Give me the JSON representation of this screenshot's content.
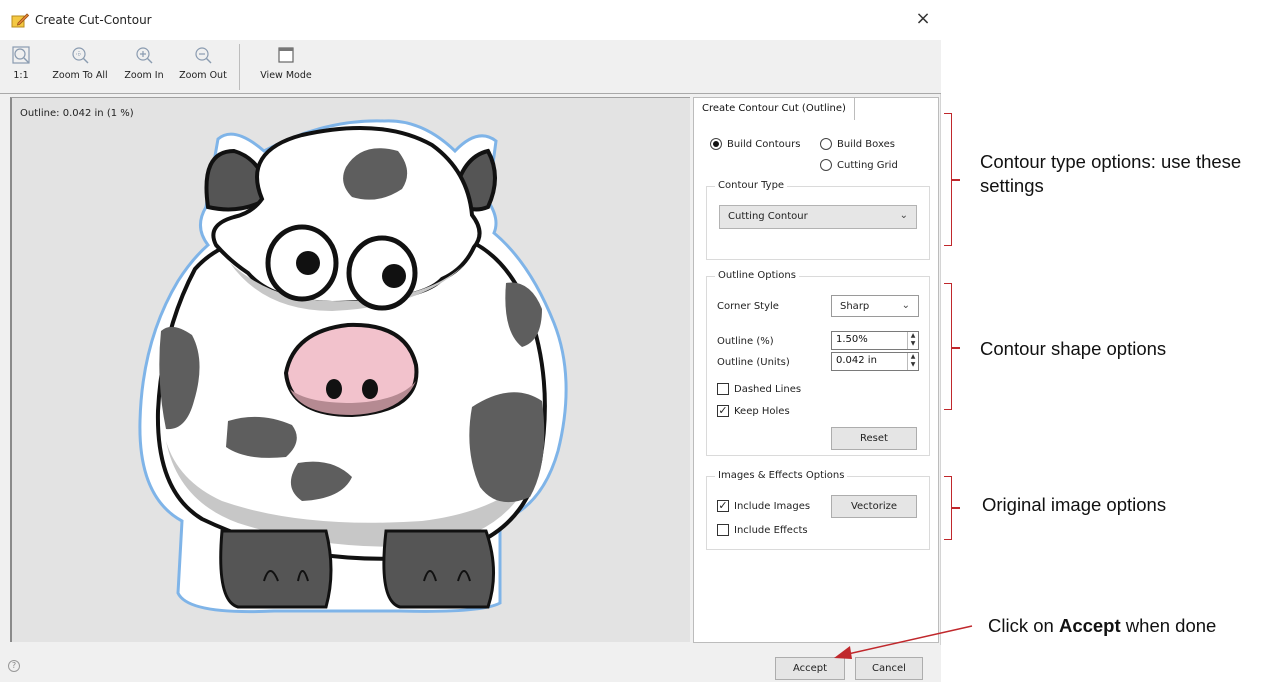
{
  "window": {
    "title": "Create Cut-Contour",
    "close_label": "×"
  },
  "toolbar": {
    "buttons": [
      {
        "label": "1:1",
        "icon": "zoom-actual-icon"
      },
      {
        "label": "Zoom To All",
        "icon": "zoom-to-all-icon"
      },
      {
        "label": "Zoom In",
        "icon": "zoom-in-icon"
      },
      {
        "label": "Zoom Out",
        "icon": "zoom-out-icon"
      },
      {
        "label": "View Mode",
        "icon": "view-mode-icon"
      }
    ]
  },
  "canvas": {
    "status": "Outline: 0.042 in (1 %)"
  },
  "panel": {
    "tab_label": "Create Contour Cut (Outline)",
    "build": {
      "contours_label": "Build Contours",
      "boxes_label": "Build Boxes",
      "grid_label": "Cutting Grid",
      "selected": "Build Contours"
    },
    "contour_type": {
      "title": "Contour Type",
      "value": "Cutting Contour"
    },
    "outline_options": {
      "title": "Outline Options",
      "corner_style_label": "Corner Style",
      "corner_style_value": "Sharp",
      "outline_pct_label": "Outline (%)",
      "outline_pct_value": "1.50%",
      "outline_units_label": "Outline (Units)",
      "outline_units_value": "0.042 in",
      "dashed_label": "Dashed Lines",
      "dashed_checked": false,
      "holes_label": "Keep Holes",
      "holes_checked": true,
      "reset_label": "Reset"
    },
    "images_effects": {
      "title": "Images & Effects Options",
      "include_images_label": "Include Images",
      "include_images_checked": true,
      "include_effects_label": "Include Effects",
      "include_effects_checked": false,
      "vectorize_label": "Vectorize"
    }
  },
  "footer": {
    "help_glyph": "?",
    "accept_label": "Accept",
    "cancel_label": "Cancel"
  },
  "annotations": {
    "contour_type_text": "Contour type options: use these settings",
    "contour_shape_text": "Contour shape options",
    "original_image_text": "Original image options",
    "accept_prefix": "Click on ",
    "accept_bold": "Accept",
    "accept_suffix": " when done",
    "accent_color": "#c0282c"
  }
}
